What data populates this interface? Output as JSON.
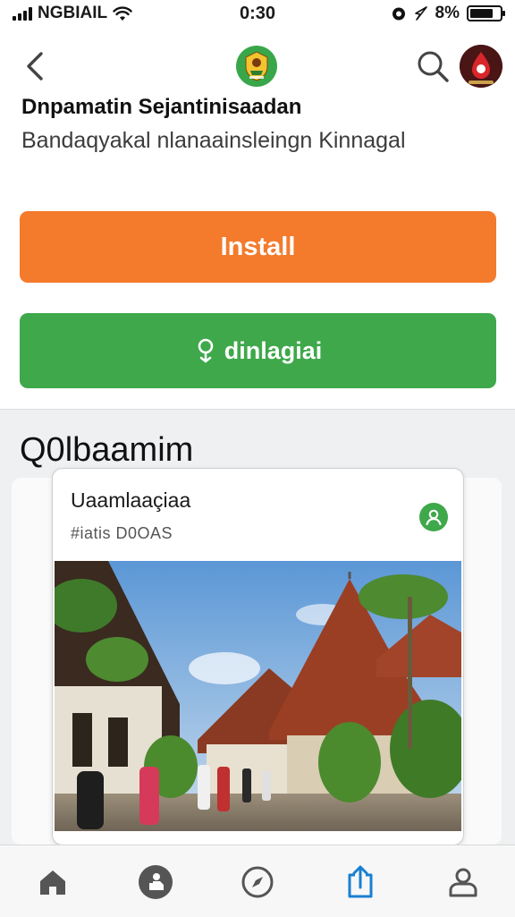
{
  "status_bar": {
    "carrier": "NGBIAIL",
    "time": "0:30",
    "battery_percent": "8%",
    "battery_level": 0.8
  },
  "nav": {
    "back_icon": "chevron-left-icon",
    "logo_icon": "app-emblem-icon",
    "search_icon": "search-icon",
    "avatar_icon": "user-avatar"
  },
  "app": {
    "title": "Dnpamatin Sejantinisaadan",
    "subtitle": "Bandaqyakal nlanaainsleingn Kinnagal"
  },
  "actions": {
    "install_label": "Install",
    "download_label": "dinlagiai",
    "download_icon": "pin-icon",
    "install_color": "#f47a2c",
    "download_color": "#3ea84a"
  },
  "section": {
    "title": "Q0lbaamim"
  },
  "card": {
    "title": "Uaamlaaçiaa",
    "tag": "#iatis D0OAS",
    "badge_icon": "user-circle-icon",
    "photo": "traditional-village-photo"
  },
  "tabbar": {
    "items": [
      {
        "icon": "home-icon"
      },
      {
        "icon": "profile-badge-icon"
      },
      {
        "icon": "compass-icon"
      },
      {
        "icon": "share-icon",
        "active": true
      },
      {
        "icon": "person-icon"
      }
    ],
    "active_color": "#1a7fd0"
  }
}
